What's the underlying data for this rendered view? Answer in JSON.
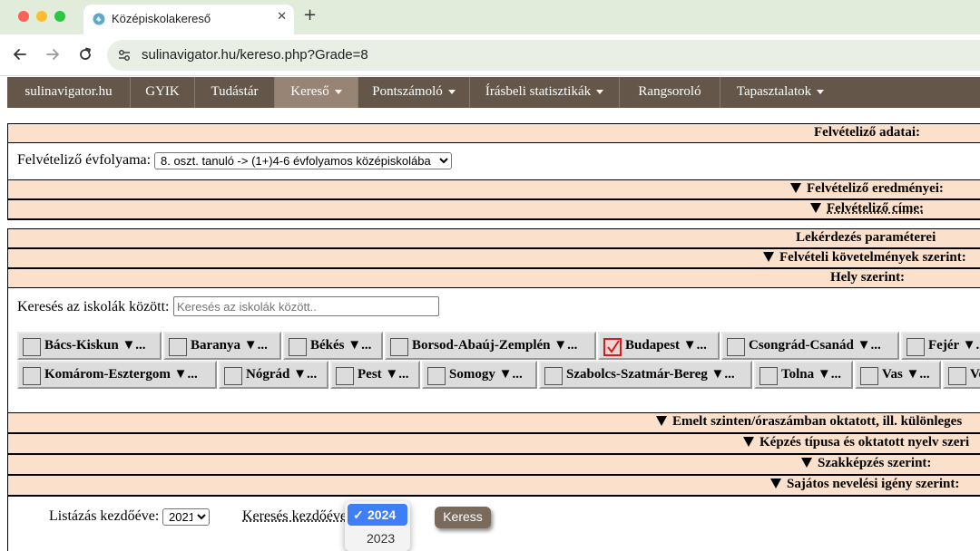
{
  "browser": {
    "tab_title": "Középiskolakereső",
    "tab_close_glyph": "✕",
    "new_tab_glyph": "+",
    "url": "sulinavigator.hu/kereso.php?Grade=8"
  },
  "nav": {
    "items": [
      {
        "label": "sulinavigator.hu",
        "dropdown": false,
        "active": false
      },
      {
        "label": "GYIK",
        "dropdown": false,
        "active": false
      },
      {
        "label": "Tudástár",
        "dropdown": false,
        "active": false
      },
      {
        "label": "Kereső",
        "dropdown": true,
        "active": true
      },
      {
        "label": "Pontszámoló",
        "dropdown": true,
        "active": false
      },
      {
        "label": "Írásbeli statisztikák",
        "dropdown": true,
        "active": false
      },
      {
        "label": "Rangsoroló",
        "dropdown": false,
        "active": false
      },
      {
        "label": "Tapasztalatok",
        "dropdown": true,
        "active": false
      }
    ]
  },
  "applicant": {
    "header": "Felvételiző adatai:",
    "grade_label": "Felvételiző évfolyama:",
    "grade_value": "8. oszt. tanuló -> (1+)4-6 évfolyamos középiskolába",
    "results_label": "Felvételiző eredményei:",
    "address_label": "Felvételiző címe:"
  },
  "query": {
    "header": "Lekérdezés paraméterei",
    "requirements_label": "Felvételi követelmények szerint:",
    "place_label": "Hely szerint:",
    "search_label": "Keresés az iskolák között:",
    "search_placeholder": "Keresés az iskolák között..",
    "more_suffix": "▼..."
  },
  "counties": {
    "row1": [
      {
        "name": "Bács-Kiskun",
        "checked": false
      },
      {
        "name": "Baranya",
        "checked": false
      },
      {
        "name": "Békés",
        "checked": false
      },
      {
        "name": "Borsod-Abaúj-Zemplén",
        "checked": false
      },
      {
        "name": "Budapest",
        "checked": true
      },
      {
        "name": "Csongrád-Csanád",
        "checked": false
      },
      {
        "name": "Fejér",
        "checked": false
      }
    ],
    "row2": [
      {
        "name": "Komárom-Esztergom",
        "checked": false
      },
      {
        "name": "Nógrád",
        "checked": false
      },
      {
        "name": "Pest",
        "checked": false
      },
      {
        "name": "Somogy",
        "checked": false
      },
      {
        "name": "Szabolcs-Szatmár-Bereg",
        "checked": false
      },
      {
        "name": "Tolna",
        "checked": false
      },
      {
        "name": "Vas",
        "checked": false
      },
      {
        "name": "Ve",
        "checked": false
      }
    ]
  },
  "sections": {
    "advanced": "Emelt szinten/óraszámban oktatott, ill. különleges",
    "training_type": "Képzés típusa és oktatott nyelv szeri",
    "vocational": "Szakképzés szerint:",
    "special_needs": "Sajátos nevelési igény szerint:"
  },
  "footer": {
    "list_start_label": "Listázás kezdőéve:",
    "list_start_value": "2021",
    "search_start_label": "Keresés kezdőéve",
    "dropdown_options": [
      "2024",
      "2023"
    ],
    "dropdown_selected": "2024",
    "check_glyph": "✓",
    "search_button": "Keress"
  },
  "colors": {
    "nav_bg": "#65564a",
    "nav_active": "#978474",
    "section_bg": "#fbe0cb",
    "button_bg": "#7a6a5c",
    "dropdown_highlight": "#3e7ef6"
  }
}
